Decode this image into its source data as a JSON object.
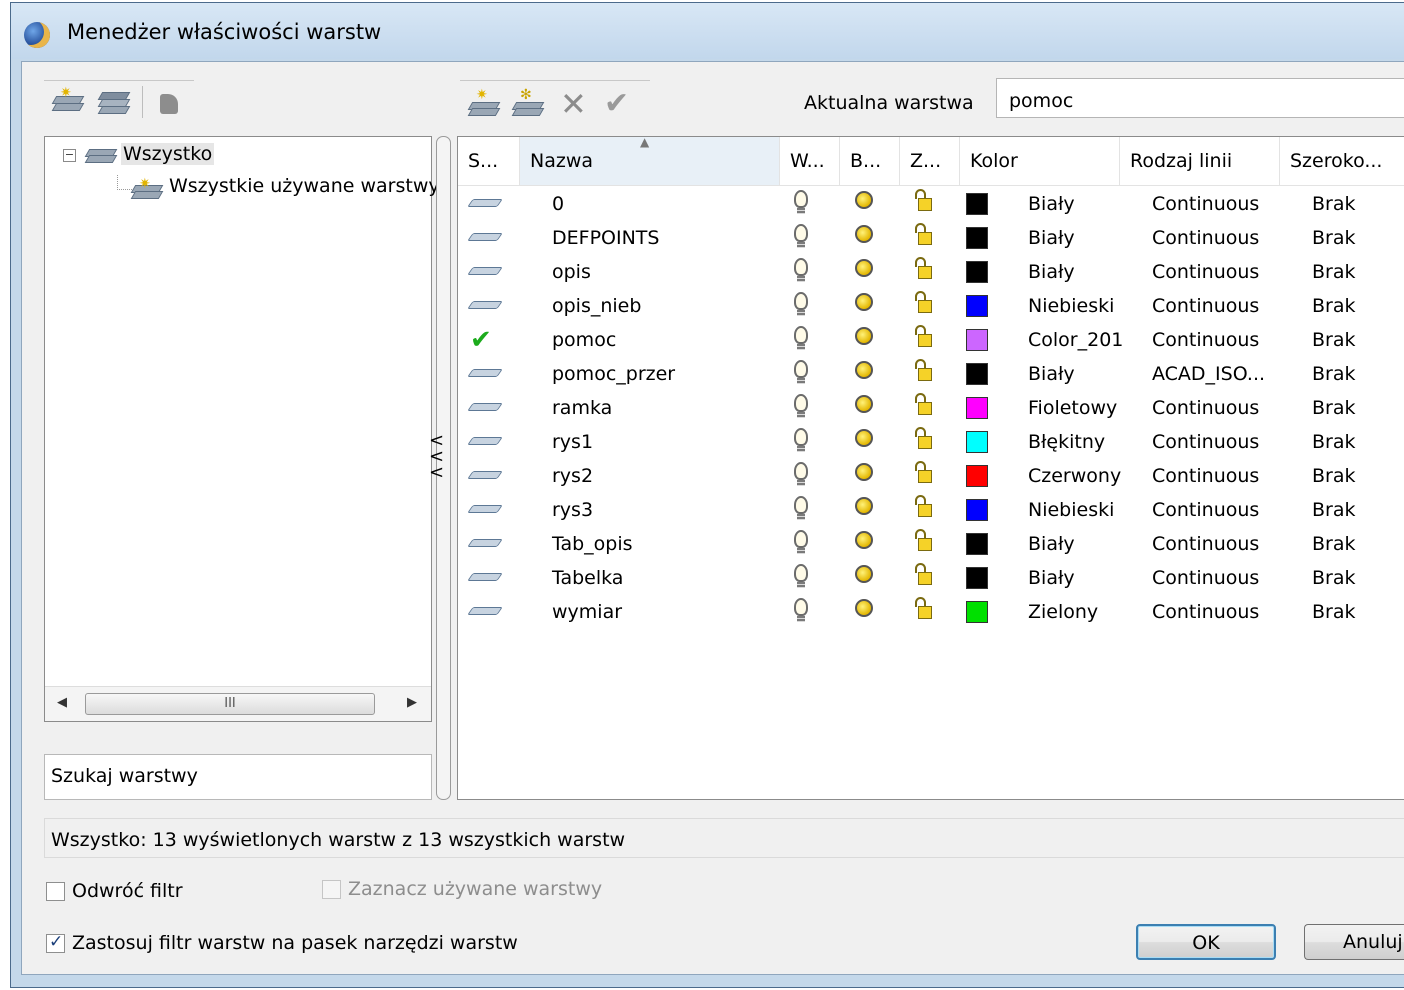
{
  "window": {
    "title": "Menedżer właściwości warstw"
  },
  "toolbar": {
    "left_icons": [
      "new-filter-icon",
      "group-filter-icon",
      "states-manager-icon"
    ],
    "right_icons": [
      "new-layer-icon",
      "new-layer-frozen-icon",
      "delete-layer-icon",
      "set-current-icon"
    ],
    "current_layer_label": "Aktualna warstwa",
    "current_layer_value": "pomoc"
  },
  "tree": {
    "root": "Wszystko",
    "child": "Wszystkie używane warstwy"
  },
  "search": {
    "placeholder": "Szukaj warstwy"
  },
  "grid": {
    "columns": [
      "S...",
      "Nazwa",
      "W...",
      "B...",
      "Z...",
      "Kolor",
      "Rodzaj linii",
      "Szeroko..."
    ],
    "sorted_column": "Nazwa",
    "rows": [
      {
        "status": "layer",
        "name": "0",
        "color_name": "Biały",
        "color_hex": "#000000",
        "linetype": "Continuous",
        "lineweight": "Brak"
      },
      {
        "status": "layer",
        "name": "DEFPOINTS",
        "color_name": "Biały",
        "color_hex": "#000000",
        "linetype": "Continuous",
        "lineweight": "Brak"
      },
      {
        "status": "layer",
        "name": "opis",
        "color_name": "Biały",
        "color_hex": "#000000",
        "linetype": "Continuous",
        "lineweight": "Brak"
      },
      {
        "status": "layer",
        "name": "opis_nieb",
        "color_name": "Niebieski",
        "color_hex": "#0000ff",
        "linetype": "Continuous",
        "lineweight": "Brak"
      },
      {
        "status": "current",
        "name": "pomoc",
        "color_name": "Color_201",
        "color_hex": "#cc66ff",
        "linetype": "Continuous",
        "lineweight": "Brak"
      },
      {
        "status": "layer",
        "name": "pomoc_przer",
        "color_name": "Biały",
        "color_hex": "#000000",
        "linetype": "ACAD_ISO...",
        "lineweight": "Brak"
      },
      {
        "status": "layer",
        "name": "ramka",
        "color_name": "Fioletowy",
        "color_hex": "#ff00ff",
        "linetype": "Continuous",
        "lineweight": "Brak"
      },
      {
        "status": "layer",
        "name": "rys1",
        "color_name": "Błękitny",
        "color_hex": "#00ffff",
        "linetype": "Continuous",
        "lineweight": "Brak"
      },
      {
        "status": "layer",
        "name": "rys2",
        "color_name": "Czerwony",
        "color_hex": "#ff0000",
        "linetype": "Continuous",
        "lineweight": "Brak"
      },
      {
        "status": "layer",
        "name": "rys3",
        "color_name": "Niebieski",
        "color_hex": "#0000ff",
        "linetype": "Continuous",
        "lineweight": "Brak"
      },
      {
        "status": "layer",
        "name": "Tab_opis",
        "color_name": "Biały",
        "color_hex": "#000000",
        "linetype": "Continuous",
        "lineweight": "Brak"
      },
      {
        "status": "layer",
        "name": "Tabelka",
        "color_name": "Biały",
        "color_hex": "#000000",
        "linetype": "Continuous",
        "lineweight": "Brak"
      },
      {
        "status": "layer",
        "name": "wymiar",
        "color_name": "Zielony",
        "color_hex": "#00e000",
        "linetype": "Continuous",
        "lineweight": "Brak"
      }
    ]
  },
  "status_bar": {
    "text": "Wszystko: 13 wyświetlonych warstw z 13 wszystkich warstw"
  },
  "options": {
    "invert_filter": {
      "label": "Odwróć filtr",
      "checked": false
    },
    "indicate_used": {
      "label": "Zaznacz używane warstwy",
      "checked": false,
      "enabled": false
    },
    "apply_filter_toolbar": {
      "label": "Zastosuj filtr warstw na pasek narzędzi warstw",
      "checked": true
    }
  },
  "buttons": {
    "ok": "OK",
    "cancel": "Anuluj"
  },
  "colors": {
    "title_bar": "#c9dcef",
    "client": "#f0f0f0",
    "accent": "#3c7fb1"
  }
}
